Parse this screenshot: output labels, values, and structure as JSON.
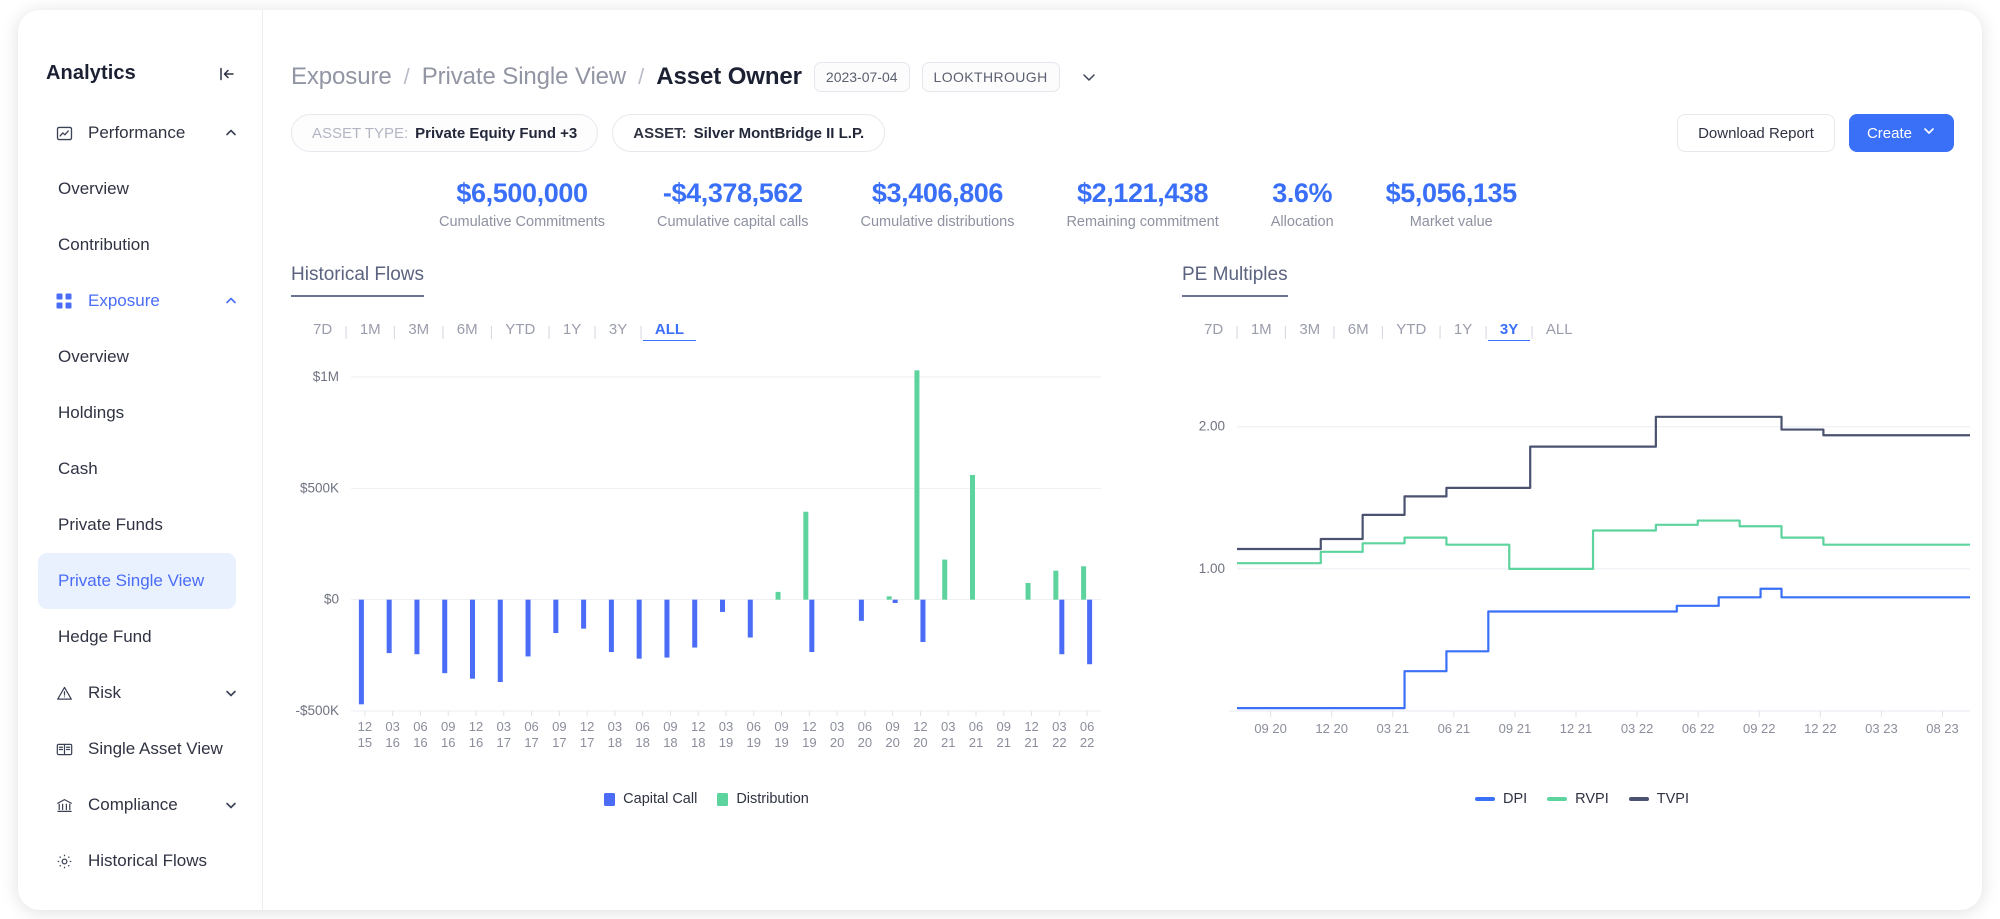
{
  "sidebar": {
    "title": "Analytics",
    "collapse_icon": "collapse-panel-icon",
    "groups": [
      {
        "label": "Performance",
        "icon": "chart-line-icon",
        "chevron": "chevron-up-icon",
        "active": false,
        "items": [
          "Overview",
          "Contribution"
        ]
      },
      {
        "label": "Exposure",
        "icon": "grid-icon",
        "chevron": "chevron-up-icon",
        "active": true,
        "items": [
          "Overview",
          "Holdings",
          "Cash",
          "Private Funds",
          "Private Single View",
          "Hedge Fund"
        ],
        "selected_item": "Private Single View"
      },
      {
        "label": "Risk",
        "icon": "warning-triangle-icon",
        "chevron": "chevron-down-icon",
        "active": false,
        "items": []
      },
      {
        "label": "Single Asset View",
        "icon": "book-open-icon",
        "chevron": "",
        "active": false,
        "items": []
      },
      {
        "label": "Compliance",
        "icon": "bank-icon",
        "chevron": "chevron-down-icon",
        "active": false,
        "items": []
      },
      {
        "label": "Historical Flows",
        "icon": "gear-icon",
        "chevron": "",
        "active": false,
        "items": []
      }
    ]
  },
  "header": {
    "breadcrumb": [
      "Exposure",
      "Private Single View",
      "Asset Owner"
    ],
    "separator": "/",
    "date_pill": "2023-07-04",
    "mode_pill": "LOOKTHROUGH",
    "dropdown_icon": "chevron-down-icon"
  },
  "filters": {
    "asset_type": {
      "key": "ASSET TYPE:",
      "value": "Private Equity Fund +3"
    },
    "asset": {
      "key": "ASSET:",
      "value": "Silver MontBridge II L.P."
    }
  },
  "actions": {
    "download_label": "Download Report",
    "create_label": "Create",
    "create_chevron": "chevron-down-icon"
  },
  "kpis": [
    {
      "value": "$6,500,000",
      "label": "Cumulative Commitments"
    },
    {
      "value": "-$4,378,562",
      "label": "Cumulative capital calls"
    },
    {
      "value": "$3,406,806",
      "label": "Cumulative distributions"
    },
    {
      "value": "$2,121,438",
      "label": "Remaining commitment"
    },
    {
      "value": "3.6%",
      "label": "Allocation"
    },
    {
      "value": "$5,056,135",
      "label": "Market value"
    }
  ],
  "colors": {
    "accent": "#3a6ff7",
    "capital_call": "#4a6cf7",
    "distribution": "#5dd39e",
    "tvpi": "#4a5270",
    "grid": "#eceef3"
  },
  "ranges": [
    "7D",
    "1M",
    "3M",
    "6M",
    "YTD",
    "1Y",
    "3Y",
    "ALL"
  ],
  "chart_data": [
    {
      "id": "historical-flows",
      "type": "bar",
      "title": "Historical Flows",
      "active_range": "ALL",
      "xlabel": "",
      "ylabel": "",
      "ylim": [
        -500000,
        1000000
      ],
      "yticks": [
        1000000,
        500000,
        0,
        -500000
      ],
      "ytick_labels": [
        "$1M",
        "$500K",
        "$0",
        "-$500K"
      ],
      "grid": true,
      "legend_position": "bottom",
      "categories": [
        "12 15",
        "03 16",
        "06 16",
        "09 16",
        "12 16",
        "03 17",
        "06 17",
        "09 17",
        "12 17",
        "03 18",
        "06 18",
        "09 18",
        "12 18",
        "03 19",
        "06 19",
        "09 19",
        "12 19",
        "03 20",
        "06 20",
        "09 20",
        "12 20",
        "03 21",
        "06 21",
        "09 21",
        "12 21",
        "03 22",
        "06 22"
      ],
      "series": [
        {
          "name": "Capital Call",
          "color": "#4a6cf7",
          "values": [
            -470000,
            -240000,
            -245000,
            -330000,
            -355000,
            -370000,
            -255000,
            -150000,
            -130000,
            -235000,
            -265000,
            -260000,
            -215000,
            -55000,
            -170000,
            0,
            -235000,
            0,
            -95000,
            -15000,
            -190000,
            0,
            0,
            0,
            0,
            -245000,
            -290000
          ]
        },
        {
          "name": "Distribution",
          "color": "#5dd39e",
          "values": [
            0,
            0,
            0,
            0,
            0,
            0,
            0,
            0,
            0,
            0,
            0,
            0,
            0,
            0,
            0,
            35000,
            395000,
            0,
            0,
            15000,
            1030000,
            180000,
            560000,
            0,
            75000,
            130000,
            150000
          ]
        }
      ]
    },
    {
      "id": "pe-multiples",
      "type": "line",
      "title": "PE Multiples",
      "active_range": "3Y",
      "xlabel": "",
      "ylabel": "",
      "ylim": [
        0.0,
        2.35
      ],
      "yticks": [
        2.0,
        1.0
      ],
      "ytick_labels": [
        "2.00",
        "1.00"
      ],
      "grid": true,
      "legend_position": "bottom",
      "xticks": [
        "09 20",
        "12 20",
        "03 21",
        "06 21",
        "09 21",
        "12 21",
        "03 22",
        "06 22",
        "09 22",
        "12 22",
        "03 23",
        "08 23"
      ],
      "series": [
        {
          "name": "DPI",
          "color": "#3a6ff7",
          "values": [
            0.02,
            0.02,
            0.02,
            0.02,
            0.02,
            0.02,
            0.02,
            0.02,
            0.28,
            0.28,
            0.42,
            0.42,
            0.7,
            0.7,
            0.7,
            0.7,
            0.7,
            0.7,
            0.7,
            0.7,
            0.7,
            0.74,
            0.74,
            0.8,
            0.8,
            0.86,
            0.8,
            0.8,
            0.8,
            0.8,
            0.8,
            0.8,
            0.8,
            0.8,
            0.8,
            0.8
          ]
        },
        {
          "name": "RVPI",
          "color": "#5dd39e",
          "values": [
            1.04,
            1.04,
            1.04,
            1.04,
            1.12,
            1.12,
            1.18,
            1.18,
            1.22,
            1.22,
            1.17,
            1.17,
            1.17,
            1.0,
            1.0,
            1.0,
            1.0,
            1.27,
            1.27,
            1.27,
            1.31,
            1.31,
            1.34,
            1.34,
            1.3,
            1.3,
            1.22,
            1.22,
            1.17,
            1.17,
            1.17,
            1.17,
            1.17,
            1.17,
            1.17,
            1.17
          ]
        },
        {
          "name": "TVPI",
          "color": "#4a5270",
          "values": [
            1.14,
            1.14,
            1.14,
            1.14,
            1.21,
            1.21,
            1.38,
            1.38,
            1.51,
            1.51,
            1.57,
            1.57,
            1.57,
            1.57,
            1.86,
            1.86,
            1.86,
            1.86,
            1.86,
            1.86,
            2.07,
            2.07,
            2.07,
            2.07,
            2.07,
            2.07,
            1.98,
            1.98,
            1.94,
            1.94,
            1.94,
            1.94,
            1.94,
            1.94,
            1.94,
            1.94
          ]
        }
      ]
    }
  ]
}
